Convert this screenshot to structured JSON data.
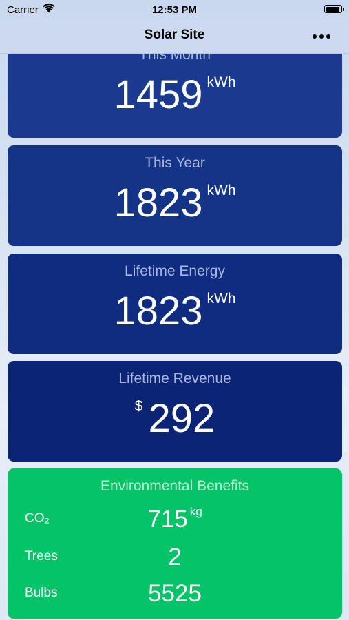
{
  "status_bar": {
    "carrier": "Carrier",
    "time": "12:53 PM",
    "icons": [
      "wifi-icon",
      "battery-icon"
    ]
  },
  "nav": {
    "title": "Solar Site",
    "more_icon": "ellipsis-icon"
  },
  "cards": [
    {
      "title": "This Month",
      "value": "1459",
      "unit": "kWh",
      "color": "#193a8e"
    },
    {
      "title": "This Year",
      "value": "1823",
      "unit": "kWh",
      "color": "#143487"
    },
    {
      "title": "Lifetime Energy",
      "value": "1823",
      "unit": "kWh",
      "color": "#0f2c80"
    },
    {
      "title": "Lifetime Revenue",
      "currency": "$",
      "value": "292",
      "color": "#0b2475"
    }
  ],
  "environment": {
    "title": "Environmental Benefits",
    "color": "#05c468",
    "rows": [
      {
        "label": "CO₂",
        "value": "715",
        "unit": "kg"
      },
      {
        "label": "Trees",
        "value": "2"
      },
      {
        "label": "Bulbs",
        "value": "5525"
      }
    ]
  }
}
